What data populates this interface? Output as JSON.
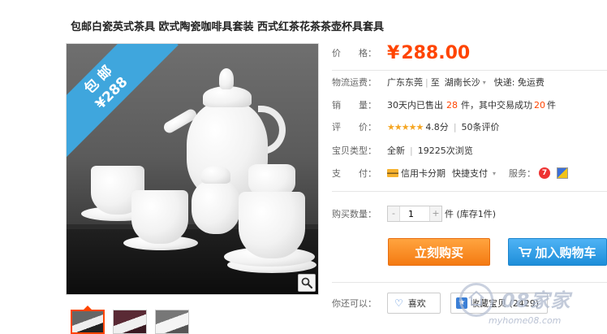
{
  "title": "包邮白瓷英式茶具 欧式陶瓷咖啡具套装 西式红茶花茶茶壶杯具套具",
  "image_badge": {
    "line1": "包 邮",
    "line2": "¥288"
  },
  "price": {
    "label": "价　　格：",
    "symbol": "¥",
    "value": "288.00"
  },
  "shipping": {
    "label": "物流运费：",
    "from": "广东东莞",
    "sep": "|",
    "to_prefix": "至",
    "to": "湖南长沙",
    "fee": "快递: 免运费"
  },
  "sales": {
    "label": "销　　量：",
    "prefix": "30天内已售出",
    "sold": "28",
    "unit1": "件，其中交易成功",
    "success": "20",
    "unit2": "件"
  },
  "rating": {
    "label": "评　　价：",
    "stars": "★★★★★",
    "score": "4.8分",
    "sep": "|",
    "count": "50条评价"
  },
  "item_type": {
    "label": "宝贝类型：",
    "condition": "全新",
    "sep": "|",
    "views": "19225次浏览"
  },
  "payment": {
    "label": "支　　付：",
    "credit": "信用卡分期",
    "quick": "快捷支付",
    "service_label": "服务：",
    "svc1": "7"
  },
  "quantity": {
    "label": "购买数量：",
    "value": "1",
    "stock": "件 (库存1件)",
    "dec": "-",
    "inc": "+"
  },
  "buttons": {
    "buy_now": "立刻购买",
    "add_cart": "加入购物车"
  },
  "actions": {
    "label": "你还可以：",
    "like": "喜欢",
    "favorite": "收藏宝贝 (2429)"
  },
  "watermark": {
    "text": "08家家",
    "url": "myhome08.com"
  },
  "colors": {
    "accent": "#ff4400",
    "buy": "#f47a12",
    "cart": "#1e8ed9",
    "star": "#f5a623",
    "ribbon": "#3fa6dd"
  }
}
